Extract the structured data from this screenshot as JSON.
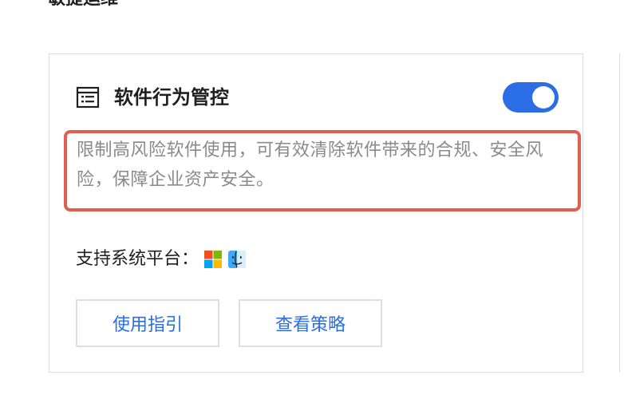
{
  "section": {
    "title": "敏捷运维"
  },
  "card": {
    "title": "软件行为管控",
    "icon": "list-document-icon",
    "toggle_on": true,
    "description": "限制高风险软件使用，可有效清除软件带来的合规、安全风险，保障企业资产安全。",
    "platform_label": "支持系统平台：",
    "platforms": [
      "windows-icon",
      "macos-finder-icon"
    ],
    "buttons": {
      "guide": "使用指引",
      "policy": "查看策略"
    }
  },
  "colors": {
    "accent": "#2b6de5",
    "highlight_border": "#e25e4e",
    "description_text": "#8a8a8a"
  }
}
